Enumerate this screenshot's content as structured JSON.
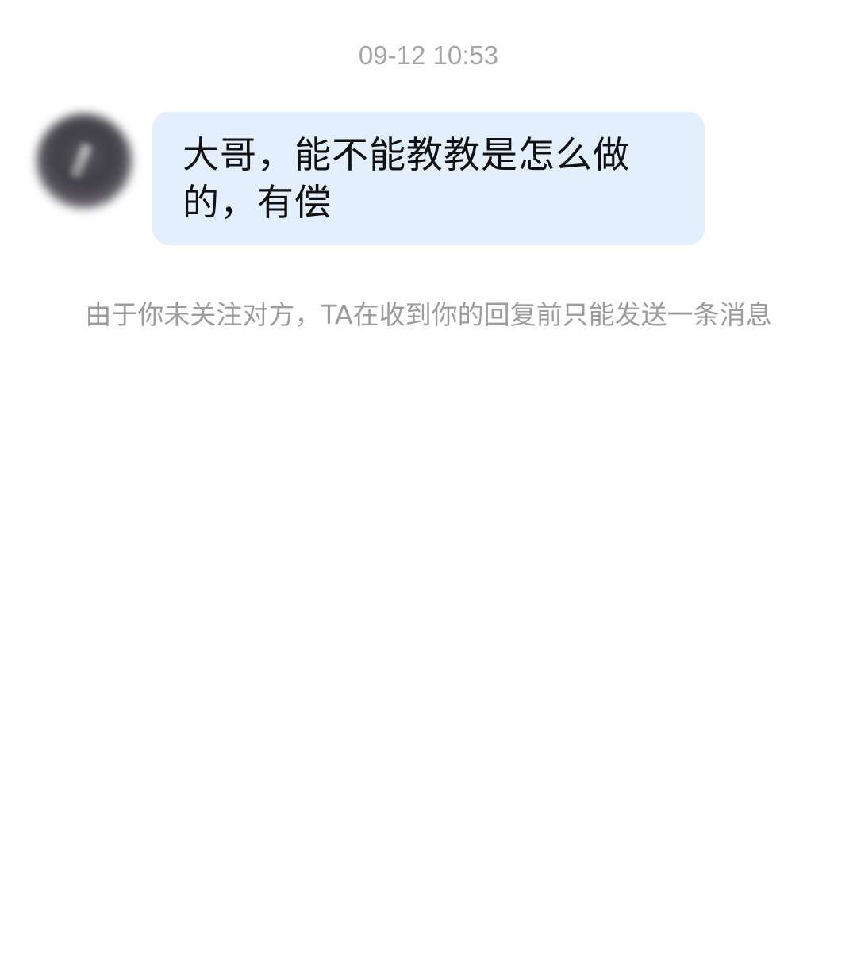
{
  "conversation": {
    "timestamp": "09-12 10:53",
    "messages": [
      {
        "sender": "other",
        "avatar_icon": "user-avatar",
        "text": "大哥，能不能教教是怎么做的，有偿",
        "bubble_color": "#e3effc"
      }
    ],
    "system_notice": "由于你未关注对方，TA在收到你的回复前只能发送一条消息"
  }
}
